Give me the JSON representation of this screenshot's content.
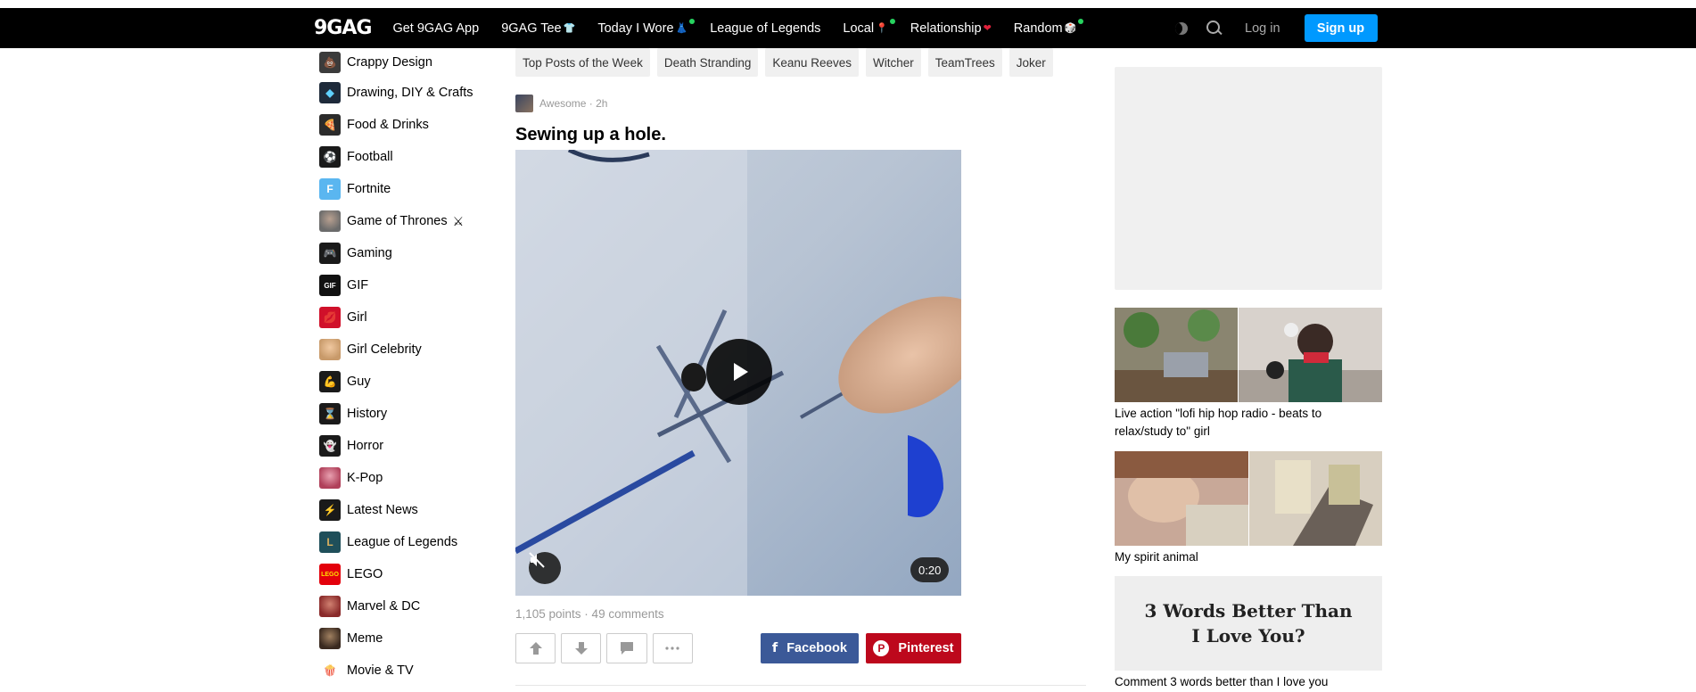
{
  "header": {
    "logo": "9GAG",
    "nav": [
      {
        "label": "Get 9GAG App",
        "emoji": "",
        "dot": false
      },
      {
        "label": "9GAG Tee",
        "emoji": "👕",
        "dot": false
      },
      {
        "label": "Today I Wore",
        "emoji": "👗",
        "dot": true
      },
      {
        "label": "League of Legends",
        "emoji": "",
        "dot": false
      },
      {
        "label": "Local",
        "emoji": "📍",
        "dot": true
      },
      {
        "label": "Relationship",
        "emoji": "❤",
        "dot": false
      },
      {
        "label": "Random",
        "emoji": "🎲",
        "dot": true
      }
    ],
    "login_label": "Log in",
    "signup_label": "Sign up",
    "accent": "#0099ff"
  },
  "sidebar": {
    "items": [
      {
        "label": "Crappy Design",
        "icon": "poop-icon",
        "color": "#3b3b3b",
        "glyph": "💩"
      },
      {
        "label": "Drawing, DIY & Crafts",
        "icon": "diamond-icon",
        "color": "#1e2a3a",
        "glyph": "◆"
      },
      {
        "label": "Food & Drinks",
        "icon": "pizza-icon",
        "color": "#2b2b2b",
        "glyph": "🍕"
      },
      {
        "label": "Football",
        "icon": "soccer-ball-icon",
        "color": "#1a1a1a",
        "glyph": "⚽"
      },
      {
        "label": "Fortnite",
        "icon": "fortnite-icon",
        "color": "#5ab6f0",
        "glyph": "F"
      },
      {
        "label": "Game of Thrones",
        "icon": "thrones-face-icon",
        "color": "#6b6b6b",
        "glyph": "",
        "trailing": "⚔"
      },
      {
        "label": "Gaming",
        "icon": "gamepad-icon",
        "color": "#1a1a1a",
        "glyph": "🎮"
      },
      {
        "label": "GIF",
        "icon": "gif-icon",
        "color": "#111111",
        "glyph": "GIF"
      },
      {
        "label": "Girl",
        "icon": "lips-icon",
        "color": "#d0102a",
        "glyph": "💋"
      },
      {
        "label": "Girl Celebrity",
        "icon": "celebrity-face-icon",
        "color": "#c89a6a",
        "glyph": ""
      },
      {
        "label": "Guy",
        "icon": "bicep-icon",
        "color": "#1a1a1a",
        "glyph": "💪"
      },
      {
        "label": "History",
        "icon": "hourglass-icon",
        "color": "#1a1a1a",
        "glyph": "⌛"
      },
      {
        "label": "Horror",
        "icon": "ghost-icon",
        "color": "#1a1a1a",
        "glyph": "👻"
      },
      {
        "label": "K-Pop",
        "icon": "kpop-face-icon",
        "color": "#b0405a",
        "glyph": ""
      },
      {
        "label": "Latest News",
        "icon": "lightning-icon",
        "color": "#1a1a1a",
        "glyph": "⚡"
      },
      {
        "label": "League of Legends",
        "icon": "league-icon",
        "color": "#1f4f5a",
        "glyph": "L"
      },
      {
        "label": "LEGO",
        "icon": "lego-icon",
        "color": "#e3000b",
        "glyph": "LEGO"
      },
      {
        "label": "Marvel & DC",
        "icon": "marvel-face-icon",
        "color": "#8a2a2a",
        "glyph": ""
      },
      {
        "label": "Meme",
        "icon": "meme-face-icon",
        "color": "#5a4a3a",
        "glyph": ""
      },
      {
        "label": "Movie & TV",
        "icon": "popcorn-icon",
        "color": "#ffffff",
        "glyph": "🍿"
      }
    ]
  },
  "tags": [
    "Top Posts of the Week",
    "Death Stranding",
    "Keanu Reeves",
    "Witcher",
    "TeamTrees",
    "Joker"
  ],
  "post": {
    "section": "Awesome",
    "age": "2h",
    "meta": "Awesome · 2h",
    "title": "Sewing up a hole.",
    "duration": "0:20",
    "stats": "1,105 points · 49 comments",
    "share_facebook": "Facebook",
    "share_pinterest": "Pinterest"
  },
  "right": {
    "featured": [
      {
        "caption": "Live action \"lofi hip hop radio - beats to relax/study to\" girl"
      },
      {
        "caption": "My spirit animal"
      },
      {
        "caption": "Comment 3 words better than I love you",
        "card_line1": "3 Words Better Than",
        "card_line2": "I Love You?"
      }
    ]
  }
}
